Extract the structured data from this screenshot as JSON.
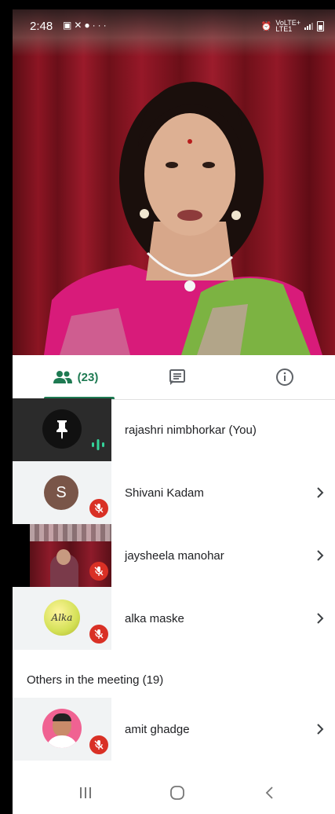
{
  "status_bar": {
    "time": "2:48",
    "network_label_line1": "VoLTE+",
    "network_label_line2": "LTE1"
  },
  "tabs": {
    "people_count": "(23)",
    "active": "people"
  },
  "participants": [
    {
      "name": "rajashri nimbhorkar (You)",
      "muted": false,
      "speaking": true,
      "has_chevron": false,
      "thumb": "pinned-self-video"
    },
    {
      "name": "Shivani Kadam",
      "muted": true,
      "has_chevron": true,
      "thumb": "avatar-initial",
      "initial": "S",
      "avatar_color": "#795548"
    },
    {
      "name": "jaysheela manohar",
      "muted": true,
      "has_chevron": true,
      "thumb": "video"
    },
    {
      "name": "alka maske",
      "muted": true,
      "has_chevron": true,
      "thumb": "image",
      "thumb_text": "Alka"
    }
  ],
  "others": {
    "heading": "Others in the meeting (19)",
    "participants": [
      {
        "name": "amit ghadge",
        "muted": true,
        "has_chevron": true,
        "thumb": "photo"
      }
    ]
  },
  "colors": {
    "accent": "#1e7a52",
    "mute_red": "#d93025",
    "speaking_green": "#34d399"
  }
}
